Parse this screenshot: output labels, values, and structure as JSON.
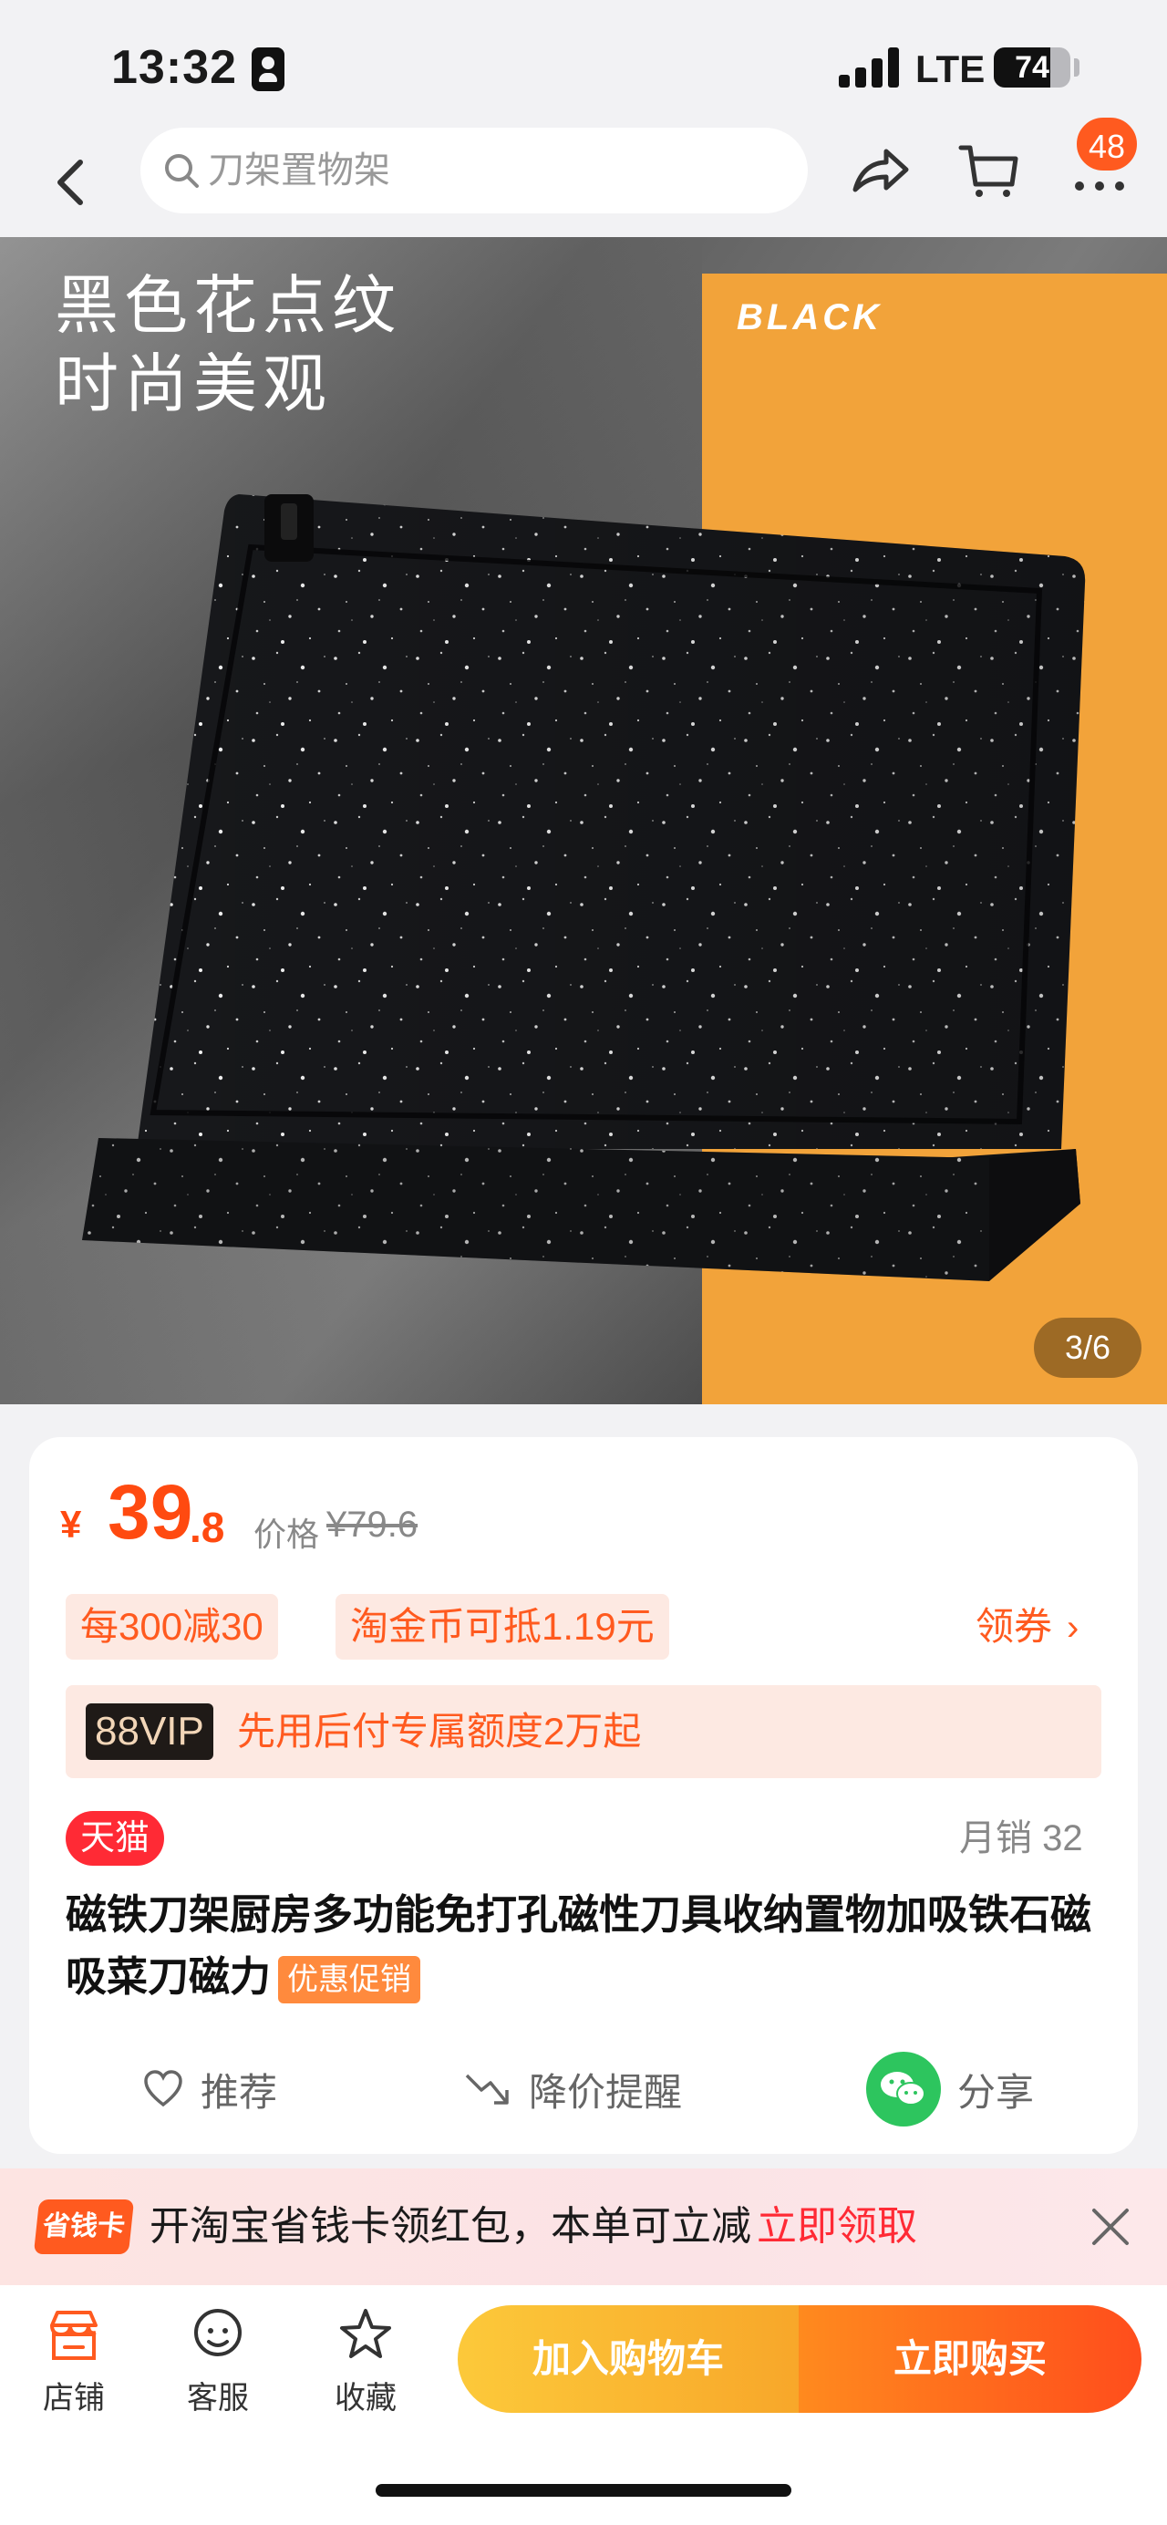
{
  "status_bar": {
    "time": "13:32",
    "network": "LTE",
    "battery": "74",
    "battery_level": 0.74
  },
  "nav": {
    "search_placeholder": "刀架置物架",
    "message_badge": "48"
  },
  "hero": {
    "title_line1": "黑色花点纹",
    "title_line2": "时尚美观",
    "tag": "BLACK",
    "page_indicator": "3/6",
    "orange_color": "#f2a33a"
  },
  "price": {
    "symbol": "¥",
    "integer": "39",
    "decimal": ".8",
    "label": "价格",
    "original": "¥79.6"
  },
  "promos": {
    "discount": "每300减30",
    "coins": "淘金币可抵1.19元",
    "coupon": "领券"
  },
  "vip": {
    "badge": "88VIP",
    "text": "先用后付专属额度2万起"
  },
  "product": {
    "store_badge": "天猫",
    "monthly_sales": "月销 32",
    "title": "磁铁刀架厨房多功能免打孔磁性刀具收纳置物加吸铁石磁吸菜刀磁力",
    "promo_badge": "优惠促销"
  },
  "actions": {
    "recommend": "推荐",
    "price_alert": "降价提醒",
    "share": "分享"
  },
  "savings_banner": {
    "logo": "省钱卡",
    "text": "开淘宝省钱卡领红包，本单可立减",
    "cta": "立即领取"
  },
  "bottom_bar": {
    "store": "店铺",
    "service": "客服",
    "favorite": "收藏",
    "add_to_cart": "加入购物车",
    "buy_now": "立即购买"
  },
  "colors": {
    "accent": "#ff5a1f",
    "price": "#ff4a10",
    "tmall": "#ff2a35"
  }
}
